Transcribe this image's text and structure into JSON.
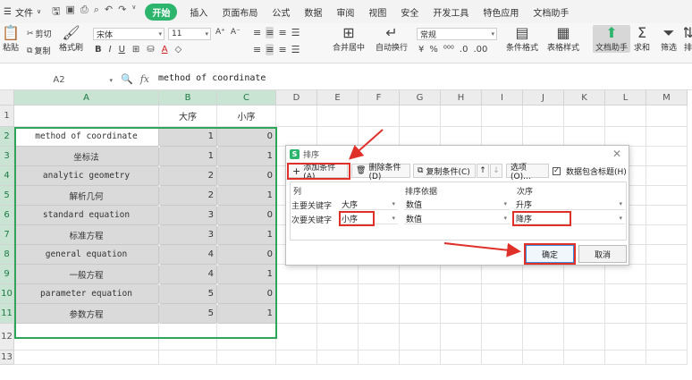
{
  "menubar": {
    "file_label": "文件",
    "start_label": "开始",
    "tabs": [
      "插入",
      "页面布局",
      "公式",
      "数据",
      "审阅",
      "视图",
      "安全",
      "开发工具",
      "特色应用",
      "文档助手"
    ]
  },
  "ribbon": {
    "paste": "粘贴",
    "cut": "剪切",
    "copy": "复制",
    "format_painter": "格式刷",
    "font_name": "宋体",
    "font_size": "11",
    "merge_center": "合并居中",
    "wrap_text": "自动换行",
    "number_format": "常规",
    "conditional_format": "条件格式",
    "table_style": "表格样式",
    "doc_assistant": "文档助手",
    "sum": "求和",
    "filter": "筛选",
    "sort_partial": "排"
  },
  "formula_bar": {
    "cell_ref": "A2",
    "fx": "fx",
    "content": "method of coordinate"
  },
  "sheet": {
    "columns": [
      "A",
      "B",
      "C",
      "D",
      "E",
      "F",
      "G",
      "H",
      "I",
      "J",
      "K",
      "L",
      "M"
    ],
    "rows": [
      "1",
      "2",
      "3",
      "4",
      "5",
      "6",
      "7",
      "8",
      "9",
      "10",
      "11",
      "12",
      "13"
    ],
    "header_b": "大序",
    "header_c": "小序",
    "data": [
      {
        "a": "method of coordinate",
        "b": "1",
        "c": "0"
      },
      {
        "a": "坐标法",
        "b": "1",
        "c": "1"
      },
      {
        "a": "analytic geometry",
        "b": "2",
        "c": "0"
      },
      {
        "a": "解析几何",
        "b": "2",
        "c": "1"
      },
      {
        "a": "standard equation",
        "b": "3",
        "c": "0"
      },
      {
        "a": "标准方程",
        "b": "3",
        "c": "1"
      },
      {
        "a": "general equation",
        "b": "4",
        "c": "0"
      },
      {
        "a": "一般方程",
        "b": "4",
        "c": "1"
      },
      {
        "a": "parameter  equation",
        "b": "5",
        "c": "0"
      },
      {
        "a": "参数方程",
        "b": "5",
        "c": "1"
      }
    ]
  },
  "dialog": {
    "title": "排序",
    "add_condition": "添加条件(A)",
    "delete_condition": "删除条件(D)",
    "copy_condition": "复制条件(C)",
    "options": "选项(O)...",
    "has_header": "数据包含标题(H)",
    "col_header": "列",
    "basis_header": "排序依据",
    "order_header": "次序",
    "primary_label": "主要关键字",
    "secondary_label": "次要关键字",
    "primary_key": "大序",
    "primary_basis": "数值",
    "primary_order": "升序",
    "secondary_key": "小序",
    "secondary_basis": "数值",
    "secondary_order": "降序",
    "ok": "确定",
    "cancel": "取消"
  },
  "colors": {
    "accent_green": "#2db46d",
    "annotation_red": "#e0302a",
    "selection_green": "#2ea65a"
  }
}
